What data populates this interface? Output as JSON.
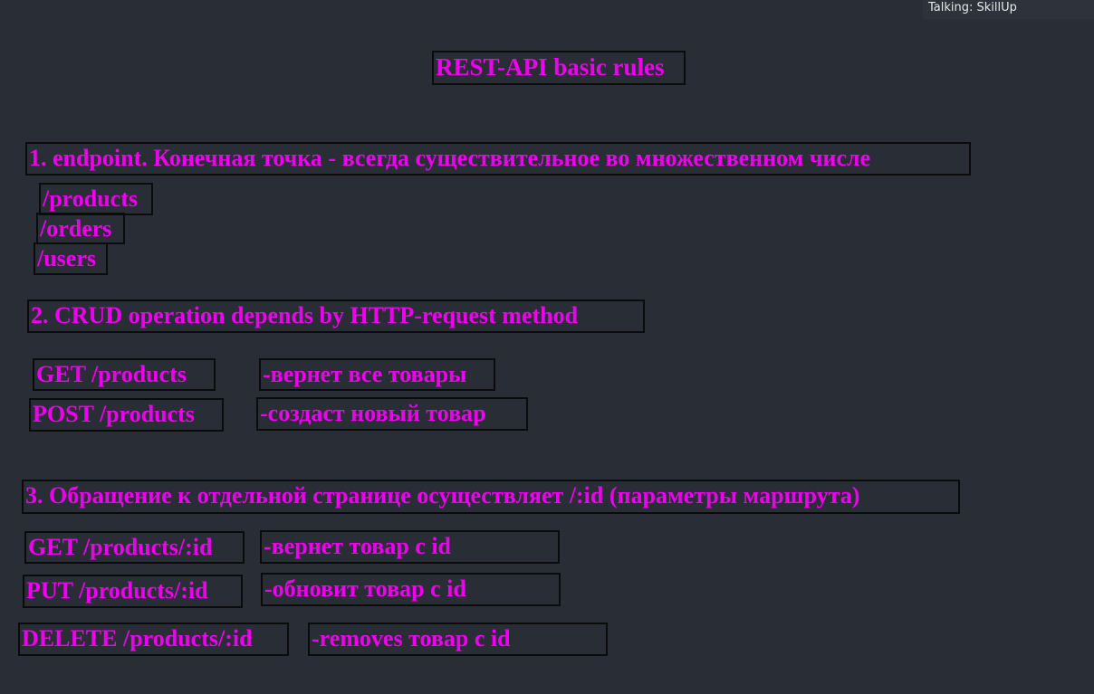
{
  "meeting": {
    "talking_indicator": "Talking: SkillUp"
  },
  "slide": {
    "title": "REST-API basic rules",
    "rule1": {
      "heading": "1. endpoint. Конечная точка - всегда существительное во множественном числе",
      "endpoints": [
        "/products",
        "/orders",
        "/users"
      ]
    },
    "rule2": {
      "heading": "2. CRUD operation depends by HTTP-request method",
      "examples": [
        {
          "request": "GET /products",
          "description": "-вернет все товары"
        },
        {
          "request": "POST /products",
          "description": "-создаст новый товар"
        }
      ]
    },
    "rule3": {
      "heading": "3. Обращение к отдельной странице осуществляет /:id (параметры маршрута)",
      "examples": [
        {
          "request": "GET /products/:id",
          "description": "-вернет товар с id"
        },
        {
          "request": "PUT /products/:id",
          "description": "-обновит товар с id"
        },
        {
          "request": "DELETE /products/:id",
          "description": "-removes товар с id"
        }
      ]
    }
  },
  "colors": {
    "background": "#292d35",
    "text": "#f000f0",
    "box_border": "#0b0b0b"
  }
}
